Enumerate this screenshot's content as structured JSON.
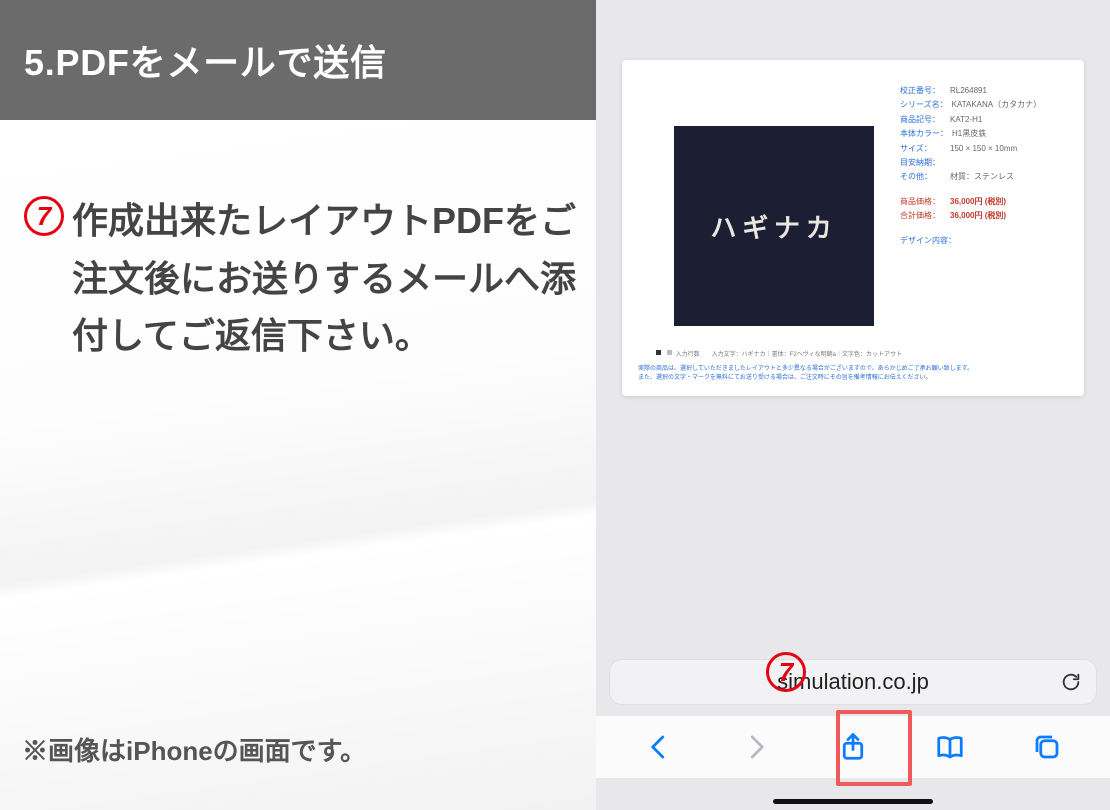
{
  "left": {
    "title": "5.PDFをメールで送信",
    "step_badge": "7",
    "step_text": "作成出来たレイアウトPDFをご注文後にお送りするメールへ添付してご返信下さい。",
    "note": "※画像はiPhoneの画面です。"
  },
  "phone": {
    "preview_text": "ハギナカ",
    "spec": {
      "proof_no_k": "校正番号：",
      "proof_no_v": "RL264891",
      "series_k": "シリーズ名：",
      "series_v": "KATAKANA（カタカナ）",
      "code_k": "商品記号：",
      "code_v": "KAT2-H1",
      "color_k": "本体カラー：",
      "color_v": "H1黒皮鉄",
      "size_k": "サイズ：",
      "size_v": "150 × 150 × 10mm",
      "due_k": "目安納期：",
      "due_v": "",
      "etc_k": "その他：",
      "etc_v": "材質：ステンレス",
      "price_k": "商品価格：",
      "price_v": "36,000円 (税別)",
      "total_k": "合計価格：",
      "total_v": "36,000円 (税別)",
      "design_k": "デザイン内容：",
      "design_v": ""
    },
    "meta_line": "入力行数　　入力文字：ハギナカ｜書体：F2ヘヴィな明朝a｜文字色：カットアウト",
    "warn_line1": "実際の商品は、選択していただきましたレイアウトと多少異なる場合がございますので、あらかじめご了承お願い致します。",
    "warn_line2": "また、選択の文字・マークを無料にてお送り受ける場合は、ご注文時にその旨を備考情報にお伝えください。",
    "address": "simulation.co.jp",
    "badge": "7"
  },
  "colors": {
    "accent_red": "#e60012",
    "ios_blue": "#0a7cff",
    "title_grey": "#6b6b6b"
  }
}
